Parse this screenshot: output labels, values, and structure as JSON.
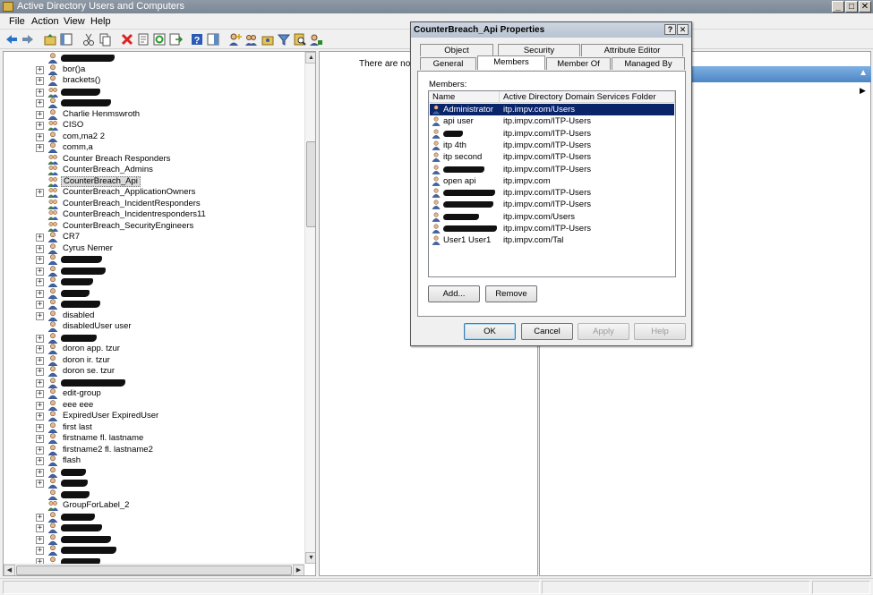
{
  "window": {
    "title": "Active Directory Users and Computers",
    "controls": [
      "_",
      "□",
      "✕"
    ]
  },
  "menu": [
    "File",
    "Action",
    "View",
    "Help"
  ],
  "tree": {
    "items": [
      {
        "label": "",
        "redact": 60,
        "exp": false,
        "icon": "user"
      },
      {
        "label": "bor()a",
        "exp": true,
        "icon": "user"
      },
      {
        "label": "brackets()",
        "exp": true,
        "icon": "user"
      },
      {
        "label": "",
        "redact": 44,
        "exp": true,
        "icon": "group"
      },
      {
        "label": "",
        "redact": 56,
        "exp": true,
        "icon": "user"
      },
      {
        "label": "Charlie Henmswroth",
        "exp": true,
        "icon": "user"
      },
      {
        "label": "CISO",
        "exp": true,
        "icon": "group"
      },
      {
        "label": "com,ma2 2",
        "exp": true,
        "icon": "user"
      },
      {
        "label": "comm,a",
        "exp": true,
        "icon": "user"
      },
      {
        "label": "Counter Breach Responders",
        "exp": false,
        "icon": "group"
      },
      {
        "label": "CounterBreach_Admins",
        "exp": false,
        "icon": "group"
      },
      {
        "label": "CounterBreach_Api",
        "exp": false,
        "icon": "group",
        "selected": true
      },
      {
        "label": "CounterBreach_ApplicationOwners",
        "exp": true,
        "icon": "group"
      },
      {
        "label": "CounterBreach_IncidentResponders",
        "exp": false,
        "icon": "group"
      },
      {
        "label": "CounterBreach_Incidentresponders11",
        "exp": false,
        "icon": "group"
      },
      {
        "label": "CounterBreach_SecurityEngineers",
        "exp": false,
        "icon": "group"
      },
      {
        "label": "CR7",
        "exp": true,
        "icon": "user"
      },
      {
        "label": "Cyrus Nemer",
        "exp": true,
        "icon": "user"
      },
      {
        "label": "",
        "redact": 46,
        "exp": true,
        "icon": "user"
      },
      {
        "label": "",
        "redact": 50,
        "exp": true,
        "icon": "user"
      },
      {
        "label": "",
        "redact": 36,
        "exp": true,
        "icon": "user"
      },
      {
        "label": "",
        "redact": 32,
        "exp": true,
        "icon": "user"
      },
      {
        "label": "",
        "redact": 44,
        "exp": true,
        "icon": "user"
      },
      {
        "label": "disabled",
        "exp": true,
        "icon": "user"
      },
      {
        "label": "disabledUser user",
        "exp": false,
        "icon": "user"
      },
      {
        "label": "",
        "redact": 40,
        "exp": true,
        "icon": "user"
      },
      {
        "label": "doron app. tzur",
        "exp": true,
        "icon": "user"
      },
      {
        "label": "doron ir. tzur",
        "exp": true,
        "icon": "user"
      },
      {
        "label": "doron se. tzur",
        "exp": true,
        "icon": "user"
      },
      {
        "label": "",
        "redact": 72,
        "exp": true,
        "icon": "user"
      },
      {
        "label": "edit-group",
        "exp": true,
        "icon": "user"
      },
      {
        "label": "eee eee",
        "exp": true,
        "icon": "user"
      },
      {
        "label": "ExpiredUser ExpiredUser",
        "exp": true,
        "icon": "user"
      },
      {
        "label": "first last",
        "exp": true,
        "icon": "user"
      },
      {
        "label": "firstname fl. lastname",
        "exp": true,
        "icon": "user"
      },
      {
        "label": "firstname2 fl. lastname2",
        "exp": true,
        "icon": "user"
      },
      {
        "label": "flash",
        "exp": true,
        "icon": "user"
      },
      {
        "label": "",
        "redact": 28,
        "exp": true,
        "icon": "user"
      },
      {
        "label": "",
        "redact": 30,
        "exp": true,
        "icon": "user"
      },
      {
        "label": "",
        "redact": 32,
        "exp": false,
        "icon": "user"
      },
      {
        "label": "GroupForLabel_2",
        "exp": false,
        "icon": "group"
      },
      {
        "label": "",
        "redact": 38,
        "exp": true,
        "icon": "user"
      },
      {
        "label": "",
        "redact": 46,
        "exp": true,
        "icon": "user"
      },
      {
        "label": "",
        "redact": 56,
        "exp": true,
        "icon": "user"
      },
      {
        "label": "",
        "redact": 62,
        "exp": true,
        "icon": "user"
      },
      {
        "label": "",
        "redact": 44,
        "exp": true,
        "icon": "user"
      }
    ]
  },
  "right": {
    "empty_message": "There are no ite"
  },
  "dialog": {
    "title": "CounterBreach_Api Properties",
    "controls": [
      "?",
      "✕"
    ],
    "tabs_row1": [
      "Object",
      "Security",
      "Attribute Editor"
    ],
    "tabs_row2": [
      "General",
      "Members",
      "Member Of",
      "Managed By"
    ],
    "members_label": "Members:",
    "columns": [
      "Name",
      "Active Directory Domain Services Folder"
    ],
    "members": [
      {
        "name": "Administrator",
        "folder": "itp.impv.com/Users",
        "selected": true
      },
      {
        "name": "api user",
        "folder": "itp.impv.com/ITP-Users"
      },
      {
        "name": "",
        "redact": 22,
        "folder": "itp.impv.com/ITP-Users"
      },
      {
        "name": "itp 4th",
        "folder": "itp.impv.com/ITP-Users"
      },
      {
        "name": "itp second",
        "folder": "itp.impv.com/ITP-Users"
      },
      {
        "name": "",
        "redact": 46,
        "folder": "itp.impv.com/ITP-Users"
      },
      {
        "name": "open api",
        "folder": "itp.impv.com"
      },
      {
        "name": "",
        "redact": 58,
        "folder": "itp.impv.com/ITP-Users"
      },
      {
        "name": "",
        "redact": 56,
        "folder": "itp.impv.com/ITP-Users"
      },
      {
        "name": "",
        "redact": 40,
        "folder": "itp.impv.com/Users"
      },
      {
        "name": "",
        "redact": 60,
        "folder": "itp.impv.com/ITP-Users"
      },
      {
        "name": "User1 User1",
        "folder": "itp.impv.com/Tal"
      }
    ],
    "add_label": "Add...",
    "remove_label": "Remove",
    "ok_label": "OK",
    "cancel_label": "Cancel",
    "apply_label": "Apply",
    "help_label": "Help"
  }
}
